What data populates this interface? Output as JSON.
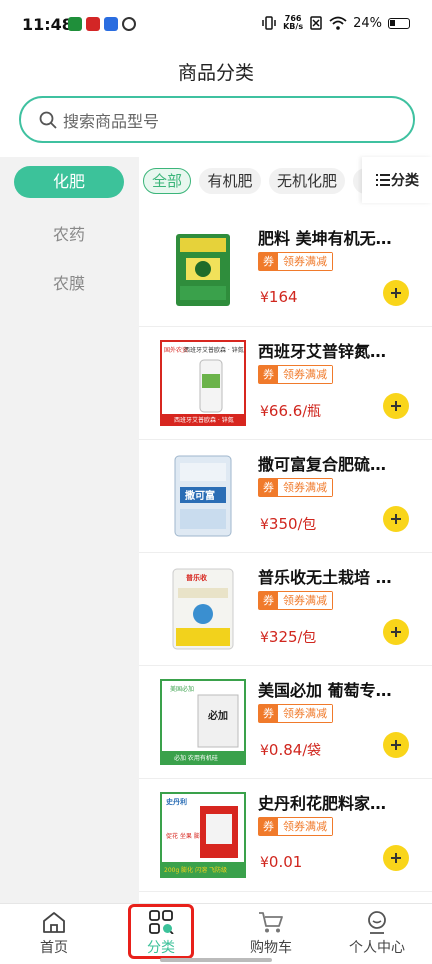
{
  "status_bar": {
    "time": "11:48",
    "net_speed_value": "766",
    "net_speed_unit": "KB/s",
    "battery": "24%"
  },
  "header": {
    "title": "商品分类"
  },
  "search": {
    "placeholder": "搜索商品型号"
  },
  "sidebar": {
    "items": [
      {
        "label": "化肥",
        "active": true
      },
      {
        "label": "农药",
        "active": false
      },
      {
        "label": "农膜",
        "active": false
      }
    ]
  },
  "filters": {
    "chips": [
      {
        "label": "全部",
        "active": true
      },
      {
        "label": "有机肥",
        "active": false
      },
      {
        "label": "无机化肥",
        "active": false
      },
      {
        "label": "微",
        "active": false
      }
    ],
    "category_button": "分类"
  },
  "coupon": {
    "tag": "券",
    "text": "领券满减"
  },
  "products": [
    {
      "title": "肥料 美坤有机无…",
      "price": "164",
      "unit": ""
    },
    {
      "title": "西班牙艾普锌氮…",
      "price": "66.6",
      "unit": "/瓶"
    },
    {
      "title": "撒可富复合肥硫…",
      "price": "350",
      "unit": "/包"
    },
    {
      "title": "普乐收无土栽培 …",
      "price": "325",
      "unit": "/包"
    },
    {
      "title": "美国必加 葡萄专…",
      "price": "0.84",
      "unit": "/袋"
    },
    {
      "title": "史丹利花肥料家…",
      "price": "0.01",
      "unit": ""
    }
  ],
  "product_images": {
    "p2_top_left": "国外农资",
    "p2_top_text": "西班牙艾普欧森 · 锌氮",
    "p2_bottom_text": "西班牙艾普欧森 · 锌氮",
    "p3_bag_text": "撒可富",
    "p4_brand": "普乐收",
    "p5_top_text": "美国必加",
    "p5_main_text": "必加",
    "p5_bottom_text": "必加 农用有机硅",
    "p6_brand": "史丹利",
    "p6_lines": "促花 坐果 膨果",
    "p6_bottom": "200g 膨化 闪溶 飞防级"
  },
  "tabs": [
    {
      "label": "首页",
      "icon": "home-icon",
      "active": false
    },
    {
      "label": "分类",
      "icon": "category-icon",
      "active": true
    },
    {
      "label": "购物车",
      "icon": "cart-icon",
      "active": false
    },
    {
      "label": "个人中心",
      "icon": "profile-icon",
      "active": false
    }
  ],
  "colors": {
    "accent": "#3cc29a",
    "price": "#d0261e",
    "coupon": "#f07a2b",
    "add_button": "#f9d51a",
    "highlight": "#e8201a"
  }
}
